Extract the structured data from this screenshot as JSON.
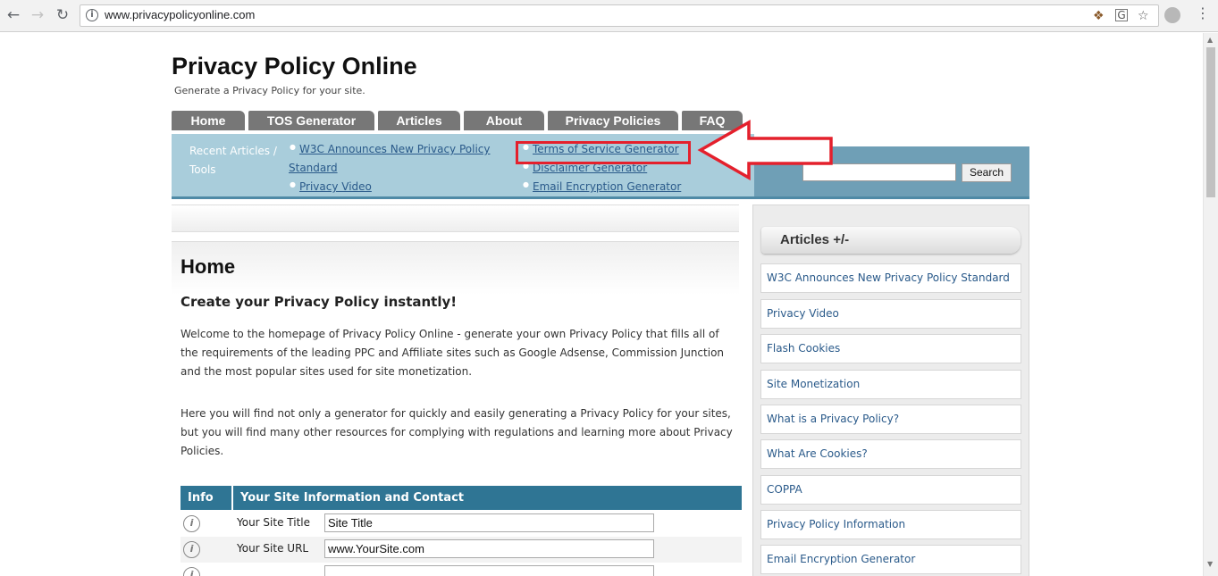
{
  "browser": {
    "url": "www.privacypolicyonline.com",
    "back_icon": "arrow-left",
    "forward_icon": "arrow-right",
    "reload_icon": "reload",
    "info_icon": "i",
    "star_icon": "☆"
  },
  "site": {
    "title": "Privacy Policy Online",
    "tagline": "Generate a Privacy Policy for your site."
  },
  "tabs": [
    {
      "label": "Home"
    },
    {
      "label": "TOS Generator"
    },
    {
      "label": "Articles"
    },
    {
      "label": "About"
    },
    {
      "label": "Privacy Policies"
    },
    {
      "label": "FAQ"
    }
  ],
  "recent": {
    "label": "Recent Articles / Tools",
    "col1": [
      "W3C Announces New Privacy Policy Standard",
      "Privacy Video"
    ],
    "col2": [
      "Terms of Service Generator",
      "Disclaimer Generator",
      "Email Encryption Generator"
    ]
  },
  "search": {
    "value": "",
    "button_label": "Search"
  },
  "main": {
    "title": "Home",
    "subtitle": "Create your Privacy Policy instantly!",
    "para1": "Welcome to the homepage of Privacy Policy Online - generate your own Privacy Policy that fills all of the requirements of the leading PPC and Affiliate sites such as Google Adsense, Commission Junction and the most popular sites used for site monetization.",
    "para2": "Here you will find not only a generator for quickly and easily generating a Privacy Policy for your sites, but you will find many other resources for complying with regulations and learning more about Privacy Policies."
  },
  "form": {
    "col_info": "Info",
    "col_main": "Your Site Information and Contact",
    "rows": [
      {
        "label": "Your Site Title",
        "value": "Site Title"
      },
      {
        "label": "Your Site URL",
        "value": "www.YourSite.com"
      },
      {
        "label": "",
        "value": ""
      }
    ]
  },
  "sidebar": {
    "heading": "Articles +/-",
    "items": [
      "W3C Announces New Privacy Policy Standard",
      "Privacy Video",
      "Flash Cookies",
      "Site Monetization",
      "What is a Privacy Policy?",
      "What Are Cookies?",
      "COPPA",
      "Privacy Policy Information",
      "Email Encryption Generator"
    ]
  },
  "colors": {
    "tab_bg": "#777777",
    "recent_bar": "#a9cddb",
    "table_header": "#2f7594",
    "annotation": "#e4202c"
  }
}
